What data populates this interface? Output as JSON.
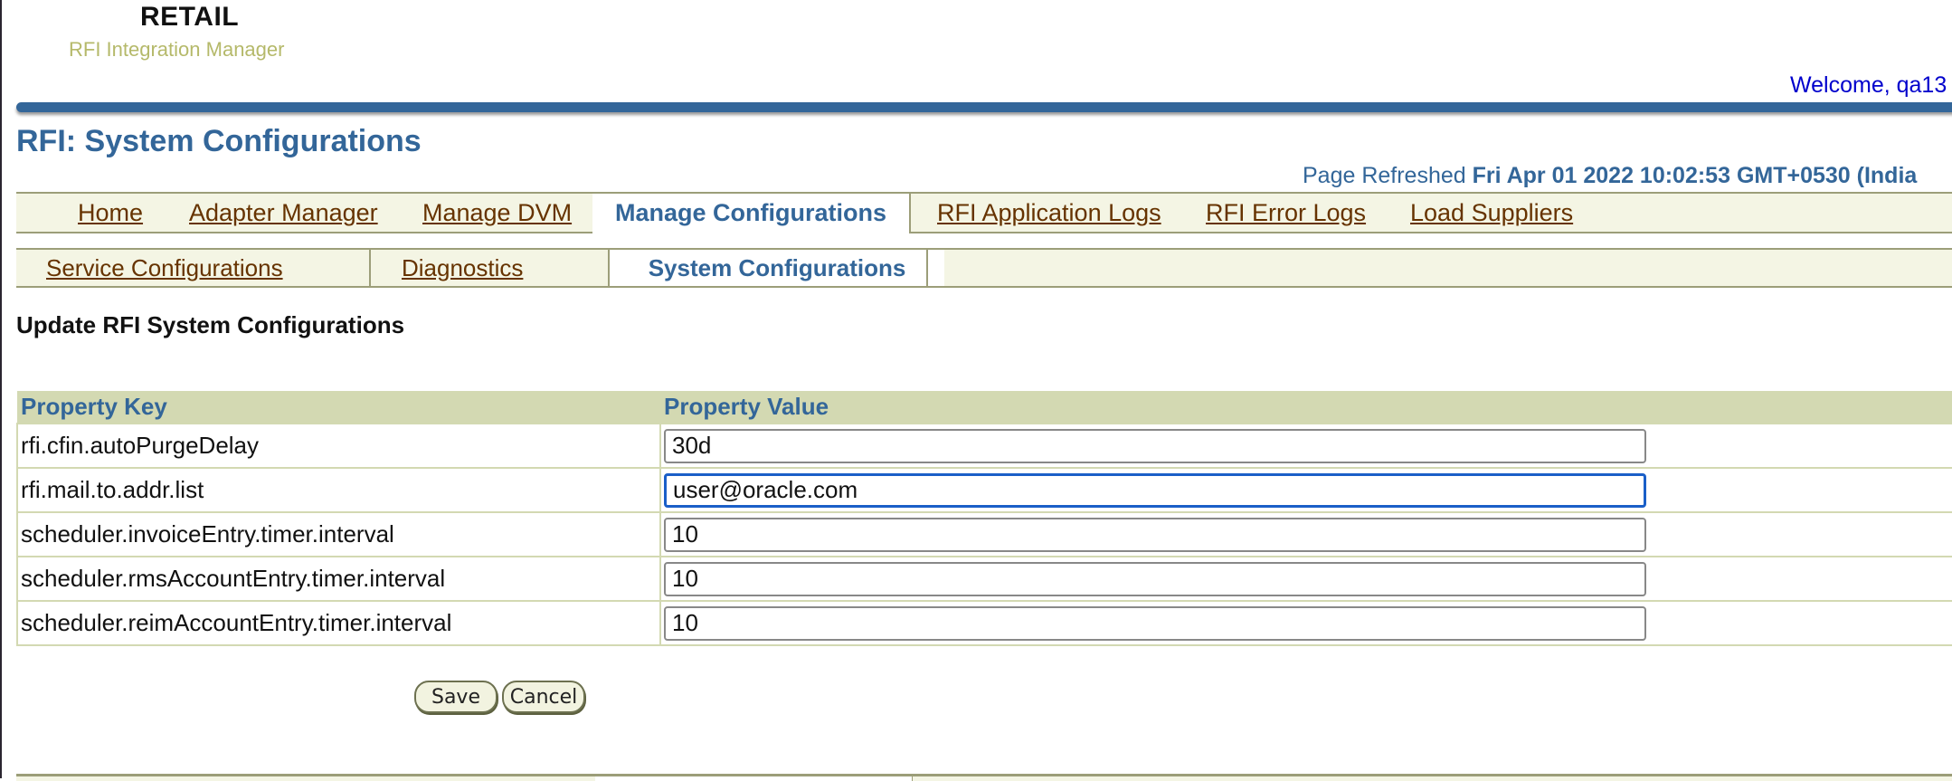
{
  "branding": {
    "product": "RETAIL",
    "app_name": "RFI Integration Manager"
  },
  "header": {
    "welcome": "Welcome, qa13"
  },
  "page": {
    "title": "RFI: System Configurations",
    "refreshed_label": "Page Refreshed",
    "refreshed_value": "Fri Apr 01 2022 10:02:53 GMT+0530 (India"
  },
  "tabs": [
    {
      "label": "Home",
      "active": false
    },
    {
      "label": "Adapter Manager",
      "active": false
    },
    {
      "label": "Manage DVM",
      "active": false
    },
    {
      "label": "Manage Configurations",
      "active": true
    },
    {
      "label": "RFI Application Logs",
      "active": false
    },
    {
      "label": "RFI Error Logs",
      "active": false
    },
    {
      "label": "Load Suppliers",
      "active": false
    }
  ],
  "subtabs": [
    {
      "label": "Service Configurations",
      "active": false
    },
    {
      "label": "Diagnostics",
      "active": false
    },
    {
      "label": "System Configurations",
      "active": true
    }
  ],
  "section": {
    "title": "Update RFI System Configurations"
  },
  "table": {
    "columns": [
      "Property Key",
      "Property Value"
    ],
    "rows": [
      {
        "key": "rfi.cfin.autoPurgeDelay",
        "value": "30d"
      },
      {
        "key": "rfi.mail.to.addr.list",
        "value": "user@oracle.com",
        "focused": true
      },
      {
        "key": "scheduler.invoiceEntry.timer.interval",
        "value": "10"
      },
      {
        "key": "scheduler.rmsAccountEntry.timer.interval",
        "value": "10"
      },
      {
        "key": "scheduler.reimAccountEntry.timer.interval",
        "value": "10"
      }
    ]
  },
  "actions": {
    "save": "Save",
    "cancel": "Cancel"
  },
  "colors": {
    "brand_blue": "#336699",
    "link_brown": "#663300",
    "tab_bg": "#f4f5e4",
    "header_row_bg": "#d3d9b2",
    "focus_blue": "#1a5fc8"
  }
}
